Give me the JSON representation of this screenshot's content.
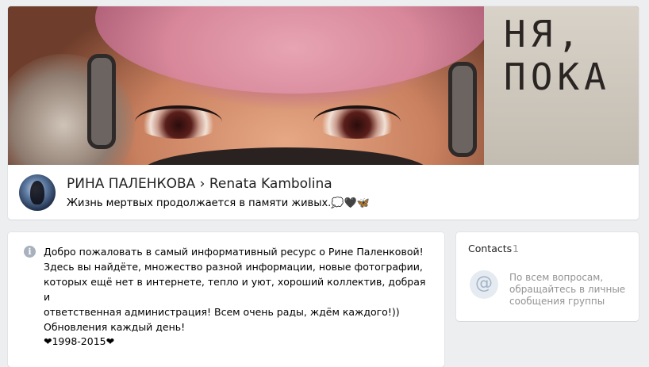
{
  "header": {
    "cover_text": "НЯ,\nПОКА",
    "title_part1": "РИНА ПАЛЕНКОВА",
    "separator": "›",
    "title_part2": "Renata Kambolina",
    "status": "Жизнь мертвых продолжается в памяти живых.💭🖤🦋"
  },
  "info": {
    "icon_glyph": "i",
    "lines": [
      "Добро пожаловать в самый информативный ресурс о Рине Паленковой!",
      "Здесь вы найдёте, множество разной информации, новые фотографии,",
      "которых ещё нет в интернете, тепло и уют, хороший коллектив, добрая и",
      "ответственная администрация! Всем очень рады, ждём каждого!))",
      "Обновления каждый день!"
    ],
    "years": "❤1998-2015❤"
  },
  "contacts": {
    "title": "Contacts",
    "count": "1",
    "icon_glyph": "@",
    "text": "По всем вопросам, обращайтесь в личные сообщения группы"
  }
}
